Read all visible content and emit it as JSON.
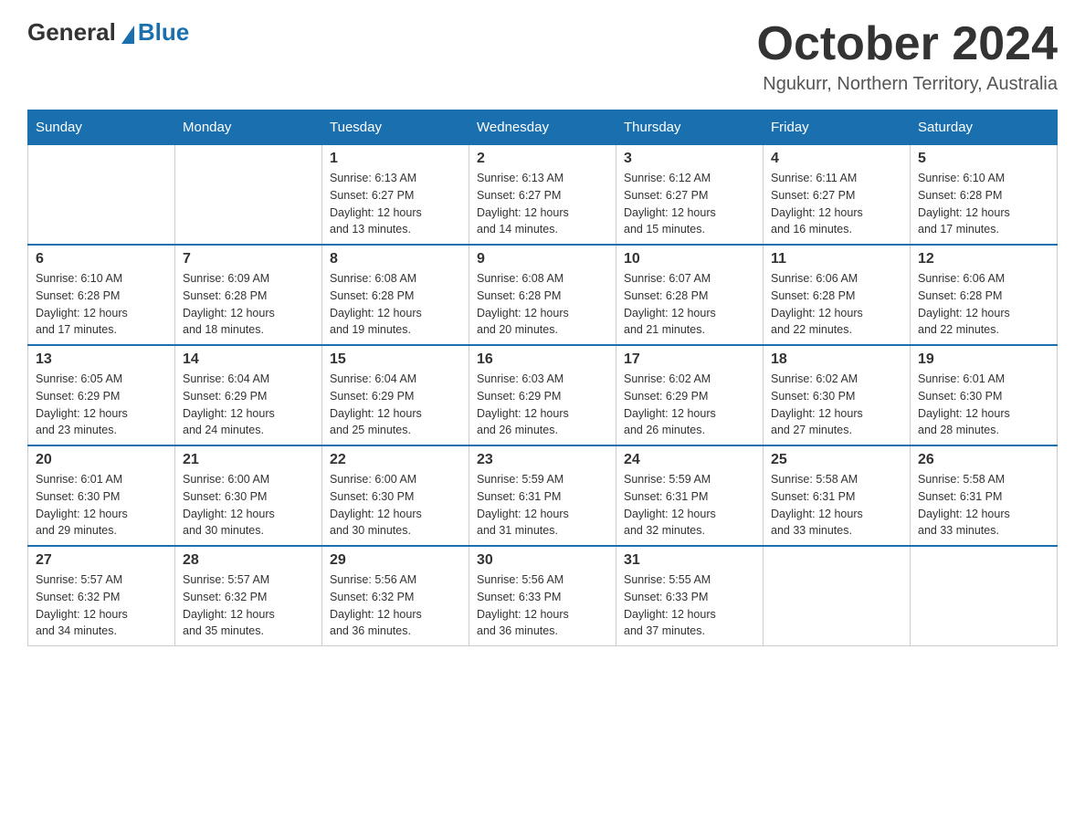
{
  "header": {
    "logo_general": "General",
    "logo_blue": "Blue",
    "month_title": "October 2024",
    "location": "Ngukurr, Northern Territory, Australia"
  },
  "weekdays": [
    "Sunday",
    "Monday",
    "Tuesday",
    "Wednesday",
    "Thursday",
    "Friday",
    "Saturday"
  ],
  "weeks": [
    [
      {
        "day": "",
        "info": ""
      },
      {
        "day": "",
        "info": ""
      },
      {
        "day": "1",
        "info": "Sunrise: 6:13 AM\nSunset: 6:27 PM\nDaylight: 12 hours\nand 13 minutes."
      },
      {
        "day": "2",
        "info": "Sunrise: 6:13 AM\nSunset: 6:27 PM\nDaylight: 12 hours\nand 14 minutes."
      },
      {
        "day": "3",
        "info": "Sunrise: 6:12 AM\nSunset: 6:27 PM\nDaylight: 12 hours\nand 15 minutes."
      },
      {
        "day": "4",
        "info": "Sunrise: 6:11 AM\nSunset: 6:27 PM\nDaylight: 12 hours\nand 16 minutes."
      },
      {
        "day": "5",
        "info": "Sunrise: 6:10 AM\nSunset: 6:28 PM\nDaylight: 12 hours\nand 17 minutes."
      }
    ],
    [
      {
        "day": "6",
        "info": "Sunrise: 6:10 AM\nSunset: 6:28 PM\nDaylight: 12 hours\nand 17 minutes."
      },
      {
        "day": "7",
        "info": "Sunrise: 6:09 AM\nSunset: 6:28 PM\nDaylight: 12 hours\nand 18 minutes."
      },
      {
        "day": "8",
        "info": "Sunrise: 6:08 AM\nSunset: 6:28 PM\nDaylight: 12 hours\nand 19 minutes."
      },
      {
        "day": "9",
        "info": "Sunrise: 6:08 AM\nSunset: 6:28 PM\nDaylight: 12 hours\nand 20 minutes."
      },
      {
        "day": "10",
        "info": "Sunrise: 6:07 AM\nSunset: 6:28 PM\nDaylight: 12 hours\nand 21 minutes."
      },
      {
        "day": "11",
        "info": "Sunrise: 6:06 AM\nSunset: 6:28 PM\nDaylight: 12 hours\nand 22 minutes."
      },
      {
        "day": "12",
        "info": "Sunrise: 6:06 AM\nSunset: 6:28 PM\nDaylight: 12 hours\nand 22 minutes."
      }
    ],
    [
      {
        "day": "13",
        "info": "Sunrise: 6:05 AM\nSunset: 6:29 PM\nDaylight: 12 hours\nand 23 minutes."
      },
      {
        "day": "14",
        "info": "Sunrise: 6:04 AM\nSunset: 6:29 PM\nDaylight: 12 hours\nand 24 minutes."
      },
      {
        "day": "15",
        "info": "Sunrise: 6:04 AM\nSunset: 6:29 PM\nDaylight: 12 hours\nand 25 minutes."
      },
      {
        "day": "16",
        "info": "Sunrise: 6:03 AM\nSunset: 6:29 PM\nDaylight: 12 hours\nand 26 minutes."
      },
      {
        "day": "17",
        "info": "Sunrise: 6:02 AM\nSunset: 6:29 PM\nDaylight: 12 hours\nand 26 minutes."
      },
      {
        "day": "18",
        "info": "Sunrise: 6:02 AM\nSunset: 6:30 PM\nDaylight: 12 hours\nand 27 minutes."
      },
      {
        "day": "19",
        "info": "Sunrise: 6:01 AM\nSunset: 6:30 PM\nDaylight: 12 hours\nand 28 minutes."
      }
    ],
    [
      {
        "day": "20",
        "info": "Sunrise: 6:01 AM\nSunset: 6:30 PM\nDaylight: 12 hours\nand 29 minutes."
      },
      {
        "day": "21",
        "info": "Sunrise: 6:00 AM\nSunset: 6:30 PM\nDaylight: 12 hours\nand 30 minutes."
      },
      {
        "day": "22",
        "info": "Sunrise: 6:00 AM\nSunset: 6:30 PM\nDaylight: 12 hours\nand 30 minutes."
      },
      {
        "day": "23",
        "info": "Sunrise: 5:59 AM\nSunset: 6:31 PM\nDaylight: 12 hours\nand 31 minutes."
      },
      {
        "day": "24",
        "info": "Sunrise: 5:59 AM\nSunset: 6:31 PM\nDaylight: 12 hours\nand 32 minutes."
      },
      {
        "day": "25",
        "info": "Sunrise: 5:58 AM\nSunset: 6:31 PM\nDaylight: 12 hours\nand 33 minutes."
      },
      {
        "day": "26",
        "info": "Sunrise: 5:58 AM\nSunset: 6:31 PM\nDaylight: 12 hours\nand 33 minutes."
      }
    ],
    [
      {
        "day": "27",
        "info": "Sunrise: 5:57 AM\nSunset: 6:32 PM\nDaylight: 12 hours\nand 34 minutes."
      },
      {
        "day": "28",
        "info": "Sunrise: 5:57 AM\nSunset: 6:32 PM\nDaylight: 12 hours\nand 35 minutes."
      },
      {
        "day": "29",
        "info": "Sunrise: 5:56 AM\nSunset: 6:32 PM\nDaylight: 12 hours\nand 36 minutes."
      },
      {
        "day": "30",
        "info": "Sunrise: 5:56 AM\nSunset: 6:33 PM\nDaylight: 12 hours\nand 36 minutes."
      },
      {
        "day": "31",
        "info": "Sunrise: 5:55 AM\nSunset: 6:33 PM\nDaylight: 12 hours\nand 37 minutes."
      },
      {
        "day": "",
        "info": ""
      },
      {
        "day": "",
        "info": ""
      }
    ]
  ]
}
